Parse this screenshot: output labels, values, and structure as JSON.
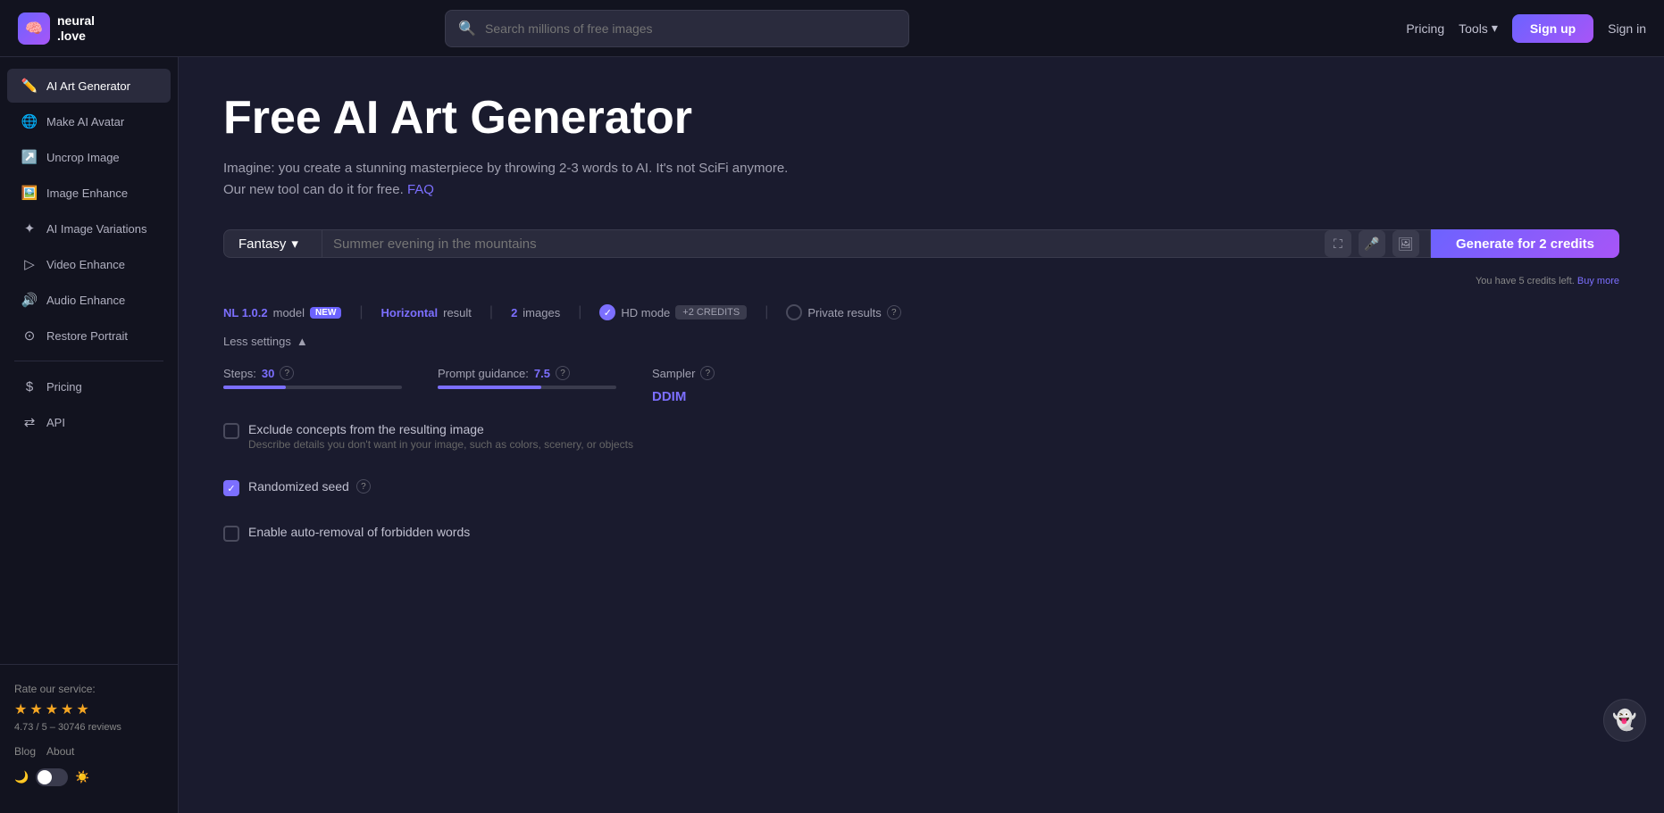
{
  "header": {
    "logo_text_line1": "neural",
    "logo_text_line2": ".love",
    "search_placeholder": "Search millions of free images",
    "pricing_label": "Pricing",
    "tools_label": "Tools",
    "signup_label": "Sign up",
    "signin_label": "Sign in"
  },
  "sidebar": {
    "items": [
      {
        "id": "ai-art-generator",
        "label": "AI Art Generator",
        "icon": "✏️"
      },
      {
        "id": "make-ai-avatar",
        "label": "Make AI Avatar",
        "icon": "🌐"
      },
      {
        "id": "uncrop-image",
        "label": "Uncrop Image",
        "icon": "↗️"
      },
      {
        "id": "image-enhance",
        "label": "Image Enhance",
        "icon": "🖼️"
      },
      {
        "id": "ai-image-variations",
        "label": "AI Image Variations",
        "icon": "✦"
      },
      {
        "id": "video-enhance",
        "label": "Video Enhance",
        "icon": "▷"
      },
      {
        "id": "audio-enhance",
        "label": "Audio Enhance",
        "icon": "🔊"
      },
      {
        "id": "restore-portrait",
        "label": "Restore Portrait",
        "icon": "⊙"
      }
    ],
    "bottom_items": [
      {
        "id": "pricing",
        "label": "Pricing",
        "icon": "$"
      },
      {
        "id": "api",
        "label": "API",
        "icon": "⇄"
      }
    ],
    "rate_label": "Rate our service:",
    "rating_value": "4.73",
    "rating_max": "5",
    "reviews_count": "30746",
    "blog_label": "Blog",
    "about_label": "About"
  },
  "page": {
    "title": "Free AI Art Generator",
    "description": "Imagine: you create a stunning masterpiece by throwing 2-3 words to AI. It's not SciFi anymore.",
    "description2": "Our new tool can do it for free.",
    "faq_label": "FAQ"
  },
  "generator": {
    "style_label": "Fantasy",
    "prompt_placeholder": "Summer evening in the mountains",
    "generate_label": "Generate for 2 credits",
    "credits_hint": "You have 5 credits left.",
    "buy_more_label": "Buy more"
  },
  "settings": {
    "model_label": "model",
    "model_value": "NL 1.0.2",
    "model_badge": "NEW",
    "result_label": "result",
    "result_value": "Horizontal",
    "images_label": "images",
    "images_value": "2",
    "hd_mode_label": "HD mode",
    "hd_credits_badge": "+2 CREDITS",
    "private_results_label": "Private results",
    "less_settings_label": "Less settings",
    "steps_label": "Steps:",
    "steps_value": "30",
    "guidance_label": "Prompt guidance:",
    "guidance_value": "7.5",
    "sampler_label": "Sampler",
    "sampler_value": "DDIM",
    "steps_fill_pct": 35,
    "guidance_fill_pct": 58,
    "exclude_label": "Exclude concepts from the resulting image",
    "exclude_sub": "Describe details you don't want in your image, such as colors, scenery, or objects",
    "randomized_seed_label": "Randomized seed",
    "auto_removal_label": "Enable auto-removal of forbidden words"
  },
  "icons": {
    "search": "🔍",
    "chevron_down": "▾",
    "resize": "⛶",
    "mic": "🎤",
    "image_upload": "🖼",
    "check": "✓",
    "question": "?"
  }
}
